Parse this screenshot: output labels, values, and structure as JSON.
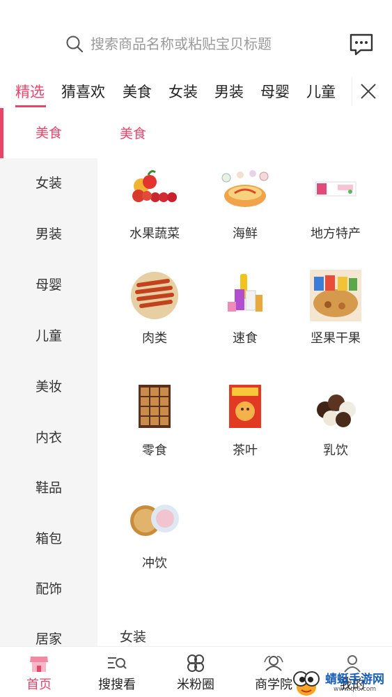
{
  "search": {
    "placeholder": "搜索商品名称或粘贴宝贝标题"
  },
  "tabs": [
    {
      "label": "精选",
      "active": true
    },
    {
      "label": "猜喜欢"
    },
    {
      "label": "美食"
    },
    {
      "label": "女装"
    },
    {
      "label": "男装"
    },
    {
      "label": "母婴"
    },
    {
      "label": "儿童"
    }
  ],
  "sidebar": {
    "items": [
      {
        "label": "美食",
        "active": true
      },
      {
        "label": "女装"
      },
      {
        "label": "男装"
      },
      {
        "label": "母婴"
      },
      {
        "label": "儿童"
      },
      {
        "label": "美妆"
      },
      {
        "label": "内衣"
      },
      {
        "label": "鞋品"
      },
      {
        "label": "箱包"
      },
      {
        "label": "配饰"
      },
      {
        "label": "居家"
      }
    ]
  },
  "main": {
    "section_title": "美食",
    "items": [
      {
        "label": "水果蔬菜",
        "icon": "fruit-vegetable-image"
      },
      {
        "label": "海鲜",
        "icon": "seafood-image"
      },
      {
        "label": "地方特产",
        "icon": "local-specialty-image"
      },
      {
        "label": "肉类",
        "icon": "meat-image"
      },
      {
        "label": "速食",
        "icon": "instant-food-image"
      },
      {
        "label": "坚果干果",
        "icon": "nuts-image"
      },
      {
        "label": "零食",
        "icon": "snack-box-image"
      },
      {
        "label": "茶叶",
        "icon": "tea-image"
      },
      {
        "label": "乳饮",
        "icon": "chocolate-image"
      },
      {
        "label": "冲饮",
        "icon": "drink-image"
      }
    ],
    "next_section_title": "女装"
  },
  "bottom_nav": [
    {
      "label": "首页",
      "icon": "shop-icon",
      "active": true
    },
    {
      "label": "搜搜看",
      "icon": "search-list-icon"
    },
    {
      "label": "米粉圈",
      "icon": "clover-icon"
    },
    {
      "label": "商学院",
      "icon": "academy-icon"
    },
    {
      "label": "我的",
      "icon": "user-icon"
    }
  ],
  "watermark": {
    "text": "蜻蜓手游网",
    "url": "www.qt6.com"
  },
  "colors": {
    "accent": "#e9446a",
    "sidebar_bg": "#f5f5f5"
  }
}
